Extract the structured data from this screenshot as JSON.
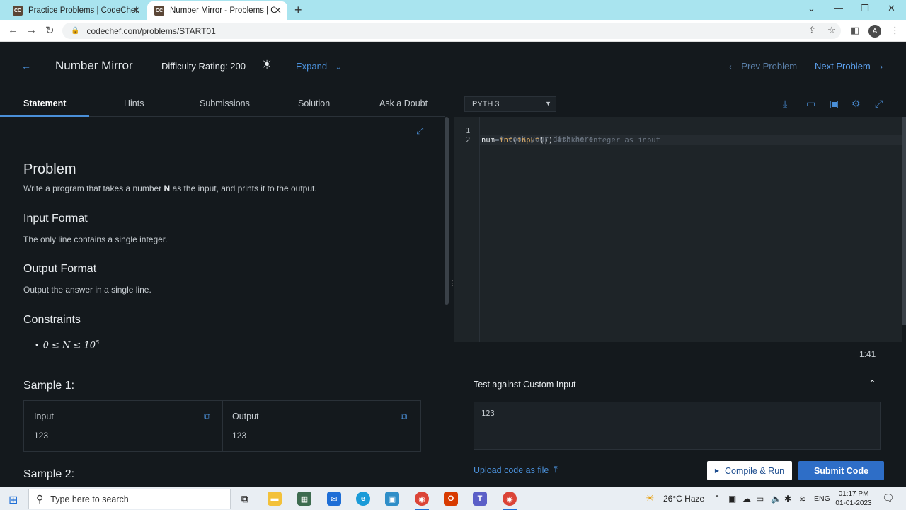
{
  "browser": {
    "tabs": [
      {
        "title": "Practice Problems | CodeChef",
        "favicon": "CC"
      },
      {
        "title": "Number Mirror - Problems | Cod",
        "favicon": "CC"
      }
    ],
    "url": "codechef.com/problems/START01",
    "profile_initial": "A"
  },
  "header": {
    "title": "Number Mirror",
    "difficulty": "Difficulty Rating: 200",
    "expand_label": "Expand",
    "prev_label": "Prev Problem",
    "next_label": "Next Problem"
  },
  "left_tabs": [
    "Statement",
    "Hints",
    "Submissions",
    "Solution",
    "Ask a Doubt"
  ],
  "statement": {
    "problem_heading": "Problem",
    "problem_text_pre": "Write a program that takes a number ",
    "problem_text_var": "N",
    "problem_text_post": " as the input, and prints it to the output.",
    "input_heading": "Input Format",
    "input_text": "The only line contains a single integer.",
    "output_heading": "Output Format",
    "output_text": "Output the answer in a single line.",
    "constraints_heading": "Constraints",
    "constraint": "0 ≤ N ≤ 10",
    "constraint_exp": "5",
    "sample1_heading": "Sample 1:",
    "sample_input_label": "Input",
    "sample_output_label": "Output",
    "sample_input_value": "123",
    "sample_output_value": "123",
    "sample2_heading": "Sample 2:"
  },
  "editor": {
    "language": "PYTH 3",
    "lines": [
      {
        "num": "1",
        "comment": "# cook your dish here"
      },
      {
        "num": "2",
        "var": "num",
        "op": "=",
        "func1": "int",
        "p1": "(",
        "func2": "input",
        "p2": "()",
        "p3": ")",
        "comment": " #takes integer as input"
      }
    ],
    "timer": "1:41"
  },
  "custom_input": {
    "title": "Test against Custom Input",
    "value": "123"
  },
  "actions": {
    "upload_label": "Upload code as file",
    "compile_label": "Compile & Run",
    "submit_label": "Submit Code"
  },
  "taskbar": {
    "search_placeholder": "Type here to search",
    "weather": "26°C  Haze",
    "lang": "ENG",
    "time": "01:17 PM",
    "date": "01-01-2023"
  }
}
